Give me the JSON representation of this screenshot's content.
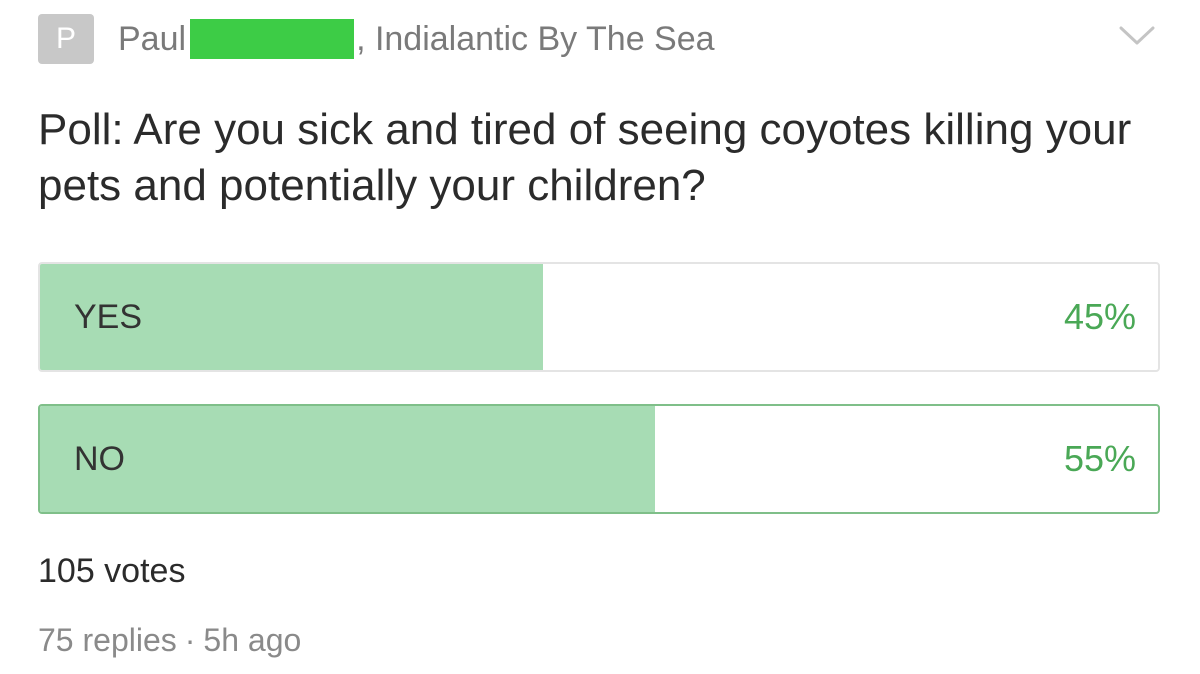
{
  "post": {
    "avatar_letter": "P",
    "author_name": "Paul",
    "author_suffix": ", Indialantic By The Sea",
    "question": "Poll: Are you sick and tired of seeing coyotes killing your pets and potentially your children?"
  },
  "poll": {
    "options": [
      {
        "label": "YES",
        "percent_text": "45%",
        "percent": 45
      },
      {
        "label": "NO",
        "percent_text": "55%",
        "percent": 55
      }
    ],
    "votes_text": "105 votes"
  },
  "footer": {
    "replies_text": "75 replies",
    "separator": "·",
    "time_text": "5h ago"
  },
  "colors": {
    "fill": "#a7dcb4",
    "percent_text": "#4aa856",
    "redaction": "#3dcc46",
    "avatar_bg": "#c8c8c8"
  },
  "icons": {
    "menu": "chevron-down-icon"
  }
}
